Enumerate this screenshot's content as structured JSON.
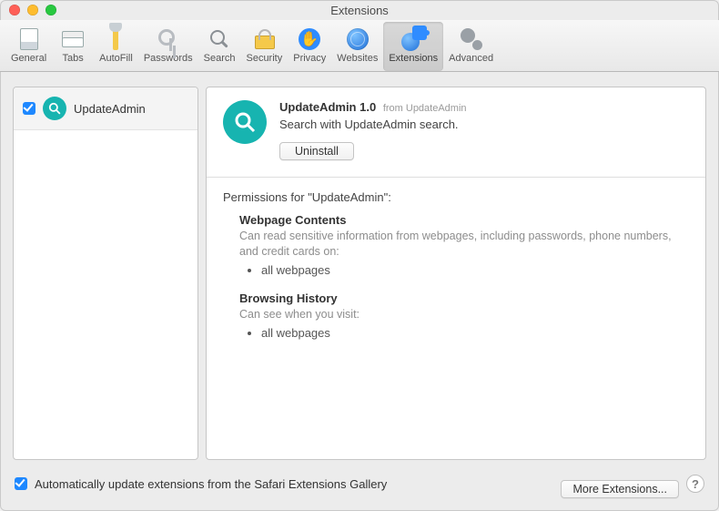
{
  "window": {
    "title": "Extensions"
  },
  "toolbar": {
    "items": [
      {
        "label": "General"
      },
      {
        "label": "Tabs"
      },
      {
        "label": "AutoFill"
      },
      {
        "label": "Passwords"
      },
      {
        "label": "Search"
      },
      {
        "label": "Security"
      },
      {
        "label": "Privacy"
      },
      {
        "label": "Websites"
      },
      {
        "label": "Extensions"
      },
      {
        "label": "Advanced"
      }
    ],
    "selected_index": 8
  },
  "sidebar": {
    "items": [
      {
        "name": "UpdateAdmin",
        "enabled": true
      }
    ]
  },
  "detail": {
    "title": "UpdateAdmin 1.0",
    "from_prefix": "from",
    "publisher": "UpdateAdmin",
    "description": "Search with UpdateAdmin search.",
    "uninstall_label": "Uninstall",
    "permissions_heading": "Permissions for \"UpdateAdmin\":",
    "permissions": [
      {
        "heading": "Webpage Contents",
        "subtext": "Can read sensitive information from webpages, including passwords, phone numbers, and credit cards on:",
        "bullets": [
          "all webpages"
        ]
      },
      {
        "heading": "Browsing History",
        "subtext": "Can see when you visit:",
        "bullets": [
          "all webpages"
        ]
      }
    ]
  },
  "footer": {
    "auto_update_label": "Automatically update extensions from the Safari Extensions Gallery",
    "auto_update_checked": true,
    "more_label": "More Extensions...",
    "help_label": "?"
  }
}
